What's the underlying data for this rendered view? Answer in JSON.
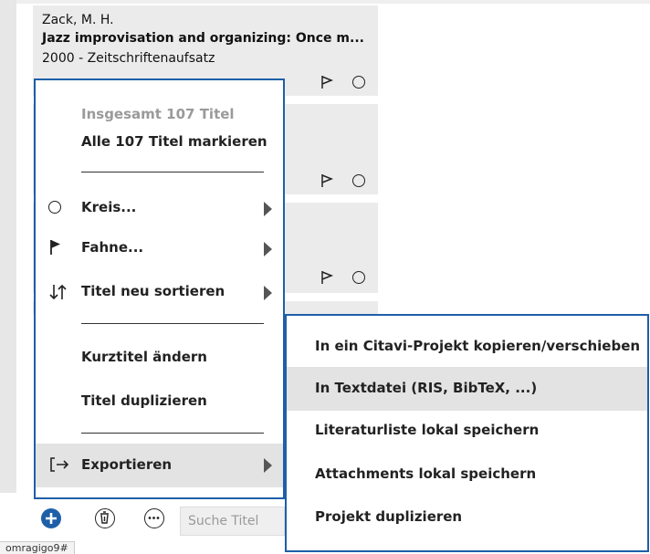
{
  "reference_card": {
    "author": "Zack, M. H.",
    "title": "Jazz improvisation and organizing: Once m...",
    "meta": "2000 - Zeitschriftenaufsatz"
  },
  "context_menu": {
    "total_label": "Insgesamt 107 Titel",
    "select_all": "Alle 107 Titel markieren",
    "circle": "Kreis...",
    "flag": "Fahne...",
    "sort": "Titel neu sortieren",
    "edit_short_title": "Kurztitel ändern",
    "duplicate_title": "Titel duplizieren",
    "export": "Exportieren"
  },
  "export_submenu": {
    "items": [
      "In ein Citavi-Projekt kopieren/verschieben",
      "In Textdatei (RIS, BibTeX, ...)",
      "Literaturliste lokal speichern",
      "Attachments lokal speichern",
      "Projekt duplizieren"
    ],
    "highlighted_index": 1
  },
  "toolbar": {
    "search_placeholder": "Suche Titel"
  },
  "status_bar": {
    "url": "omragigo9#"
  },
  "colors": {
    "accent": "#1e5fa8",
    "card_bg": "#ebebeb",
    "highlight": "#e3e3e3"
  },
  "icons": [
    "flag-outline-icon",
    "circle-outline-icon",
    "flag-filled-icon",
    "sort-arrows-icon",
    "export-icon",
    "chevron-right-icon",
    "add-icon",
    "trash-icon",
    "more-icon"
  ]
}
